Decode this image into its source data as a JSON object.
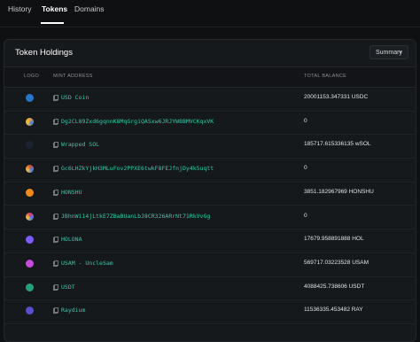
{
  "tabs": [
    {
      "label": "History"
    },
    {
      "label": "Tokens"
    },
    {
      "label": "Domains"
    }
  ],
  "panel": {
    "title": "Token Holdings",
    "summary_label": "Summary"
  },
  "table": {
    "columns": [
      "LOGO",
      "MINT ADDRESS",
      "TOTAL BALANCE"
    ],
    "rows": [
      {
        "logo_icon": "usdc-icon",
        "logo_color": "#2775ca",
        "mint": "USD Coin",
        "balance": "20001153.347331 USDC"
      },
      {
        "logo_icon": "gradient-circle-icon",
        "logo_color": "#e8a33a",
        "mint": "Dg2CL89Zxd6gqnnK8MqGrgiQASxw6JRJYW8BMVCKqxVK",
        "balance": "0"
      },
      {
        "logo_icon": "wrapped-sol-icon",
        "logo_color": "#1c2230",
        "mint": "Wrapped SOL",
        "balance": "185717.615336135 wSOL"
      },
      {
        "logo_icon": "gradient-circle-icon",
        "logo_color": "#d9562e",
        "mint": "Gc6LHZkYjkH3MLuFov2PPXE6twkF8FEJfnjDy4k5uqtt",
        "balance": "0"
      },
      {
        "logo_icon": "honshu-icon",
        "logo_color": "#f08a1c",
        "mint": "HONSHU",
        "balance": "3851.182967969 HONSHU"
      },
      {
        "logo_icon": "gradient-circle-icon",
        "logo_color": "#e0406a",
        "mint": "JBhnWi14jLtkE7ZBaBUanLbJ8CR326ARrNt71RkVvGg",
        "balance": "0"
      },
      {
        "logo_icon": "holona-icon",
        "logo_color": "#7c5cff",
        "mint": "HOLONA",
        "balance": "17679.958891888 HOL"
      },
      {
        "logo_icon": "usam-icon",
        "logo_color": "#c64bdc",
        "mint": "USAM - UncleSam",
        "balance": "569717.03223528 USAM"
      },
      {
        "logo_icon": "usdt-icon",
        "logo_color": "#26a17b",
        "mint": "USDT",
        "balance": "4088425.738606 USDT"
      },
      {
        "logo_icon": "raydium-icon",
        "logo_color": "#5a4fcf",
        "mint": "Raydium",
        "balance": "11536335.453482 RAY"
      }
    ]
  }
}
